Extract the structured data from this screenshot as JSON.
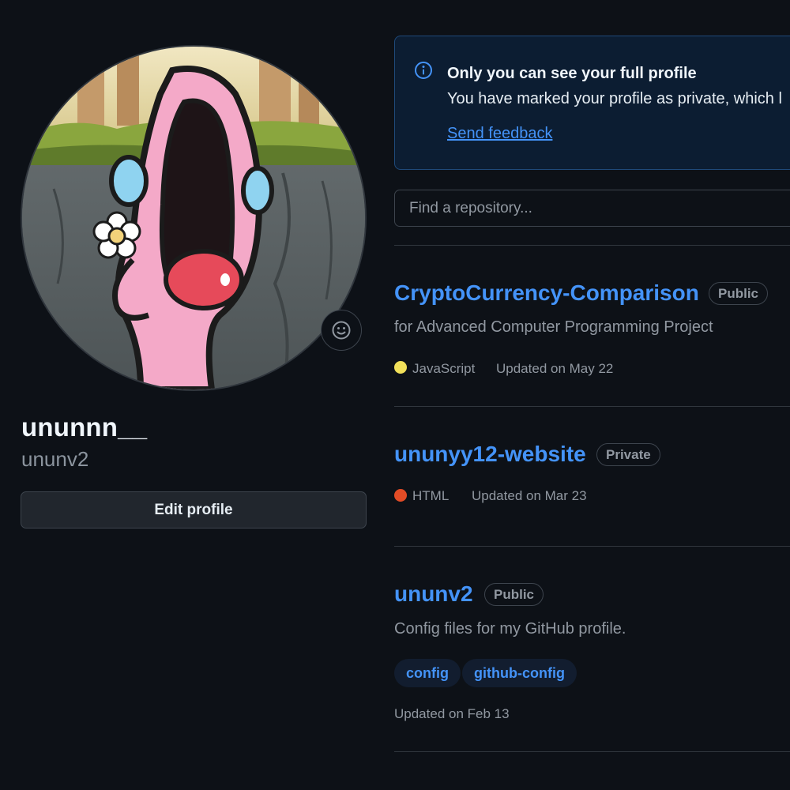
{
  "profile": {
    "display_name": "ununnn__",
    "username": "ununv2",
    "edit_profile_label": "Edit profile",
    "avatar_alt": "avatar",
    "status_icon": "smiley-icon"
  },
  "notice": {
    "icon": "info-icon",
    "title": "Only you can see your full profile",
    "body": "You have marked your profile as private, which l",
    "link": "Send feedback"
  },
  "repo_search": {
    "placeholder": "Find a repository..."
  },
  "repos": [
    {
      "name": "CryptoCurrency-Comparison",
      "visibility": "Public",
      "description": "for Advanced Computer Programming Project",
      "language": "JavaScript",
      "language_color": "#f1e05a",
      "updated": "Updated on May 22"
    },
    {
      "name": "ununyy12-website",
      "visibility": "Private",
      "language": "HTML",
      "language_color": "#e34c26",
      "updated": "Updated on Mar 23"
    },
    {
      "name": "ununv2",
      "visibility": "Public",
      "description": "Config files for my GitHub profile.",
      "topics": [
        "config",
        "github-config"
      ],
      "updated": "Updated on Feb 13"
    }
  ],
  "colors": {
    "background": "#0d1117",
    "link": "#4493f8",
    "muted": "#9198a1",
    "border": "#3d444d"
  }
}
